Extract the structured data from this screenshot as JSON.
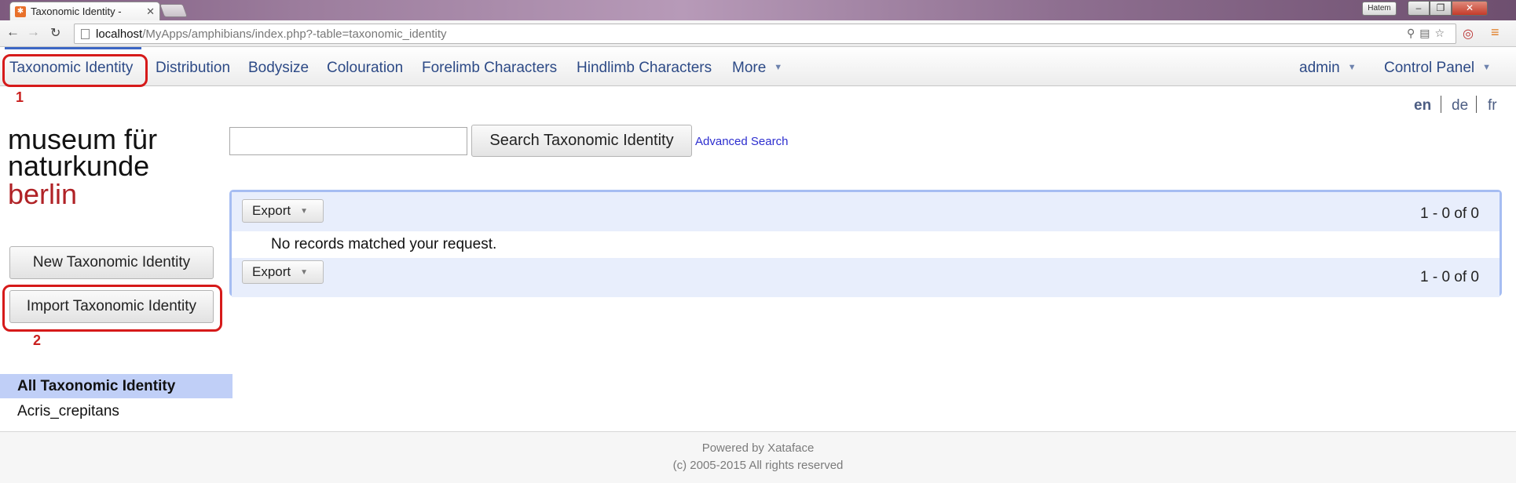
{
  "browser": {
    "tab_title": "Taxonomic Identity - ",
    "tab_close": "✕",
    "favicon": "✱",
    "user_badge": "Hatem",
    "url_host": "localhost",
    "url_path": "/MyApps/amphibians/index.php?-table=taxonomic_identity"
  },
  "nav": {
    "items": [
      {
        "label": "Taxonomic Identity"
      },
      {
        "label": "Distribution"
      },
      {
        "label": "Bodysize"
      },
      {
        "label": "Colouration"
      },
      {
        "label": "Forelimb Characters"
      },
      {
        "label": "Hindlimb Characters"
      },
      {
        "label": "More"
      }
    ],
    "admin_label": "admin",
    "control_panel_label": "Control Panel"
  },
  "annotations": {
    "first": "1",
    "second": "2",
    "color": "#d61a1a"
  },
  "languages": [
    "en",
    "de",
    "fr"
  ],
  "logo": {
    "line1": "museum für",
    "line2": "naturkunde",
    "line3": "berlin",
    "accent_color": "#b02226"
  },
  "search": {
    "value": "",
    "button_label": "Search Taxonomic Identity",
    "advanced_link": "Advanced Search"
  },
  "sidebar": {
    "new_button": "New Taxonomic Identity",
    "import_button": "Import Taxonomic Identity",
    "all_label": "All Taxonomic Identity",
    "items": [
      "Acris_crepitans"
    ]
  },
  "results": {
    "export_label": "Export",
    "pager_text": "1 - 0 of 0",
    "empty_message": "No records matched your request."
  },
  "footer": {
    "powered_by": "Powered by Xataface",
    "copyright": "(c) 2005-2015 All rights reserved"
  }
}
